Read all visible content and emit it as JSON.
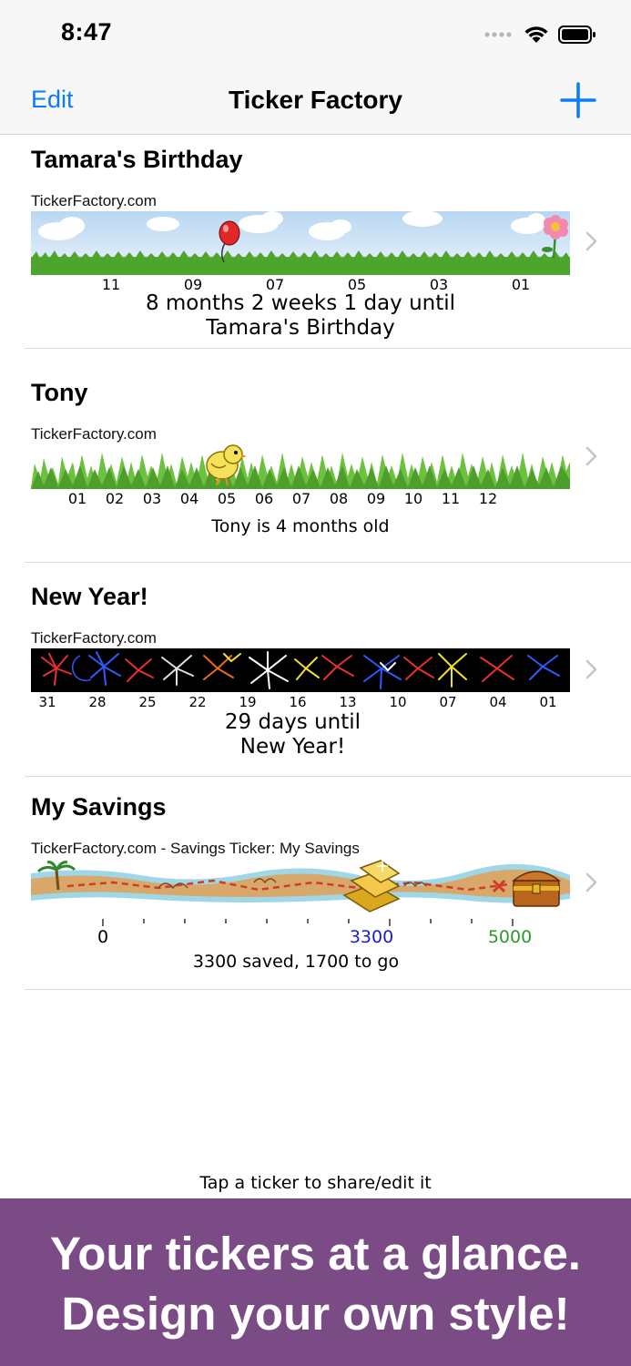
{
  "status_bar": {
    "time": "8:47"
  },
  "nav": {
    "edit_label": "Edit",
    "title": "Ticker Factory",
    "add_icon": "plus-icon"
  },
  "tickers": [
    {
      "title": "Tamara's Birthday",
      "source": "TickerFactory.com",
      "theme": "balloon-meadow",
      "ticks": [
        "11",
        "09",
        "07",
        "05",
        "03",
        "01"
      ],
      "caption_line1": "8 months 2 weeks 1 day  until",
      "caption_line2": "Tamara's Birthday"
    },
    {
      "title": "Tony",
      "source": "TickerFactory.com",
      "theme": "chick-grass",
      "ticks": [
        "01",
        "02",
        "03",
        "04",
        "05",
        "06",
        "07",
        "08",
        "09",
        "10",
        "11",
        "12"
      ],
      "caption_line1": "Tony is 4 months old"
    },
    {
      "title": "New Year!",
      "source": "TickerFactory.com",
      "theme": "fireworks",
      "ticks": [
        "31",
        "28",
        "25",
        "22",
        "19",
        "16",
        "13",
        "10",
        "07",
        "04",
        "01"
      ],
      "caption_line1": "29 days until",
      "caption_line2": "New Year!"
    },
    {
      "title": "My Savings",
      "source": "TickerFactory.com - Savings Ticker: My Savings",
      "theme": "treasure-map",
      "scale_start": "0",
      "current_value": "3300",
      "goal_value": "5000",
      "progress": 0.66,
      "caption_line1": "3300 saved, 1700 to go"
    }
  ],
  "colors": {
    "accent": "#0a7aff",
    "promo_bg": "#7b4b85",
    "current": "#1a1ad6",
    "goal": "#2e9a2e"
  },
  "footer_hint": "Tap a ticker to share/edit it",
  "promo": {
    "line1": "Your tickers at a glance.",
    "line2": "Design your own style!"
  }
}
